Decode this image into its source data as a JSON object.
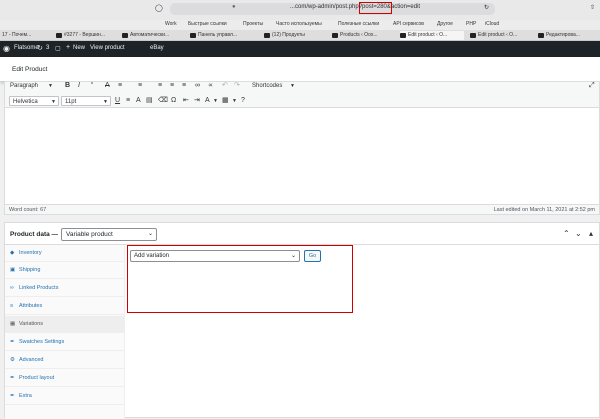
{
  "browser": {
    "url": "...com/wp-admin/post.php?post=280&action=edit",
    "bookmarks": [
      "Work",
      "Быстрые ссылки",
      "Проекты",
      "Часто используемы",
      "Полезные ссылки",
      "API сервисов",
      "Другое",
      "PHP",
      "iCloud"
    ],
    "tabs": [
      "17 - Почем...",
      "#3277 - Вершин...",
      "Автоматически...",
      "Панель управл...",
      "(12) Продукты",
      "Products ‹ Oox...",
      "Edit product ‹ O...",
      "Edit product ‹ O...",
      "Редактирова..."
    ]
  },
  "adminbar": {
    "site": "Flatsome",
    "updates": "3",
    "new": "New",
    "view": "View product",
    "ebay": "eBay"
  },
  "page": {
    "title": "Edit Product"
  },
  "editor": {
    "format": "Paragraph",
    "font": "Helvetica",
    "size": "11pt",
    "shortcodes": "Shortcodes",
    "word_count": "Word count: 67",
    "last_edited": "Last edited on March 11, 2021 at 2:52 pm"
  },
  "product_data": {
    "label": "Product data —",
    "type": "Variable product",
    "tabs": [
      "Inventory",
      "Shipping",
      "Linked Products",
      "Attributes",
      "Variations",
      "Swatches Settings",
      "Advanced",
      "Product layout",
      "Extra"
    ],
    "add_variation": "Add variation",
    "go": "Go"
  },
  "colors": {
    "accent": "#2271b1",
    "highlight": "#d10000",
    "adminbar": "#1d2327"
  }
}
